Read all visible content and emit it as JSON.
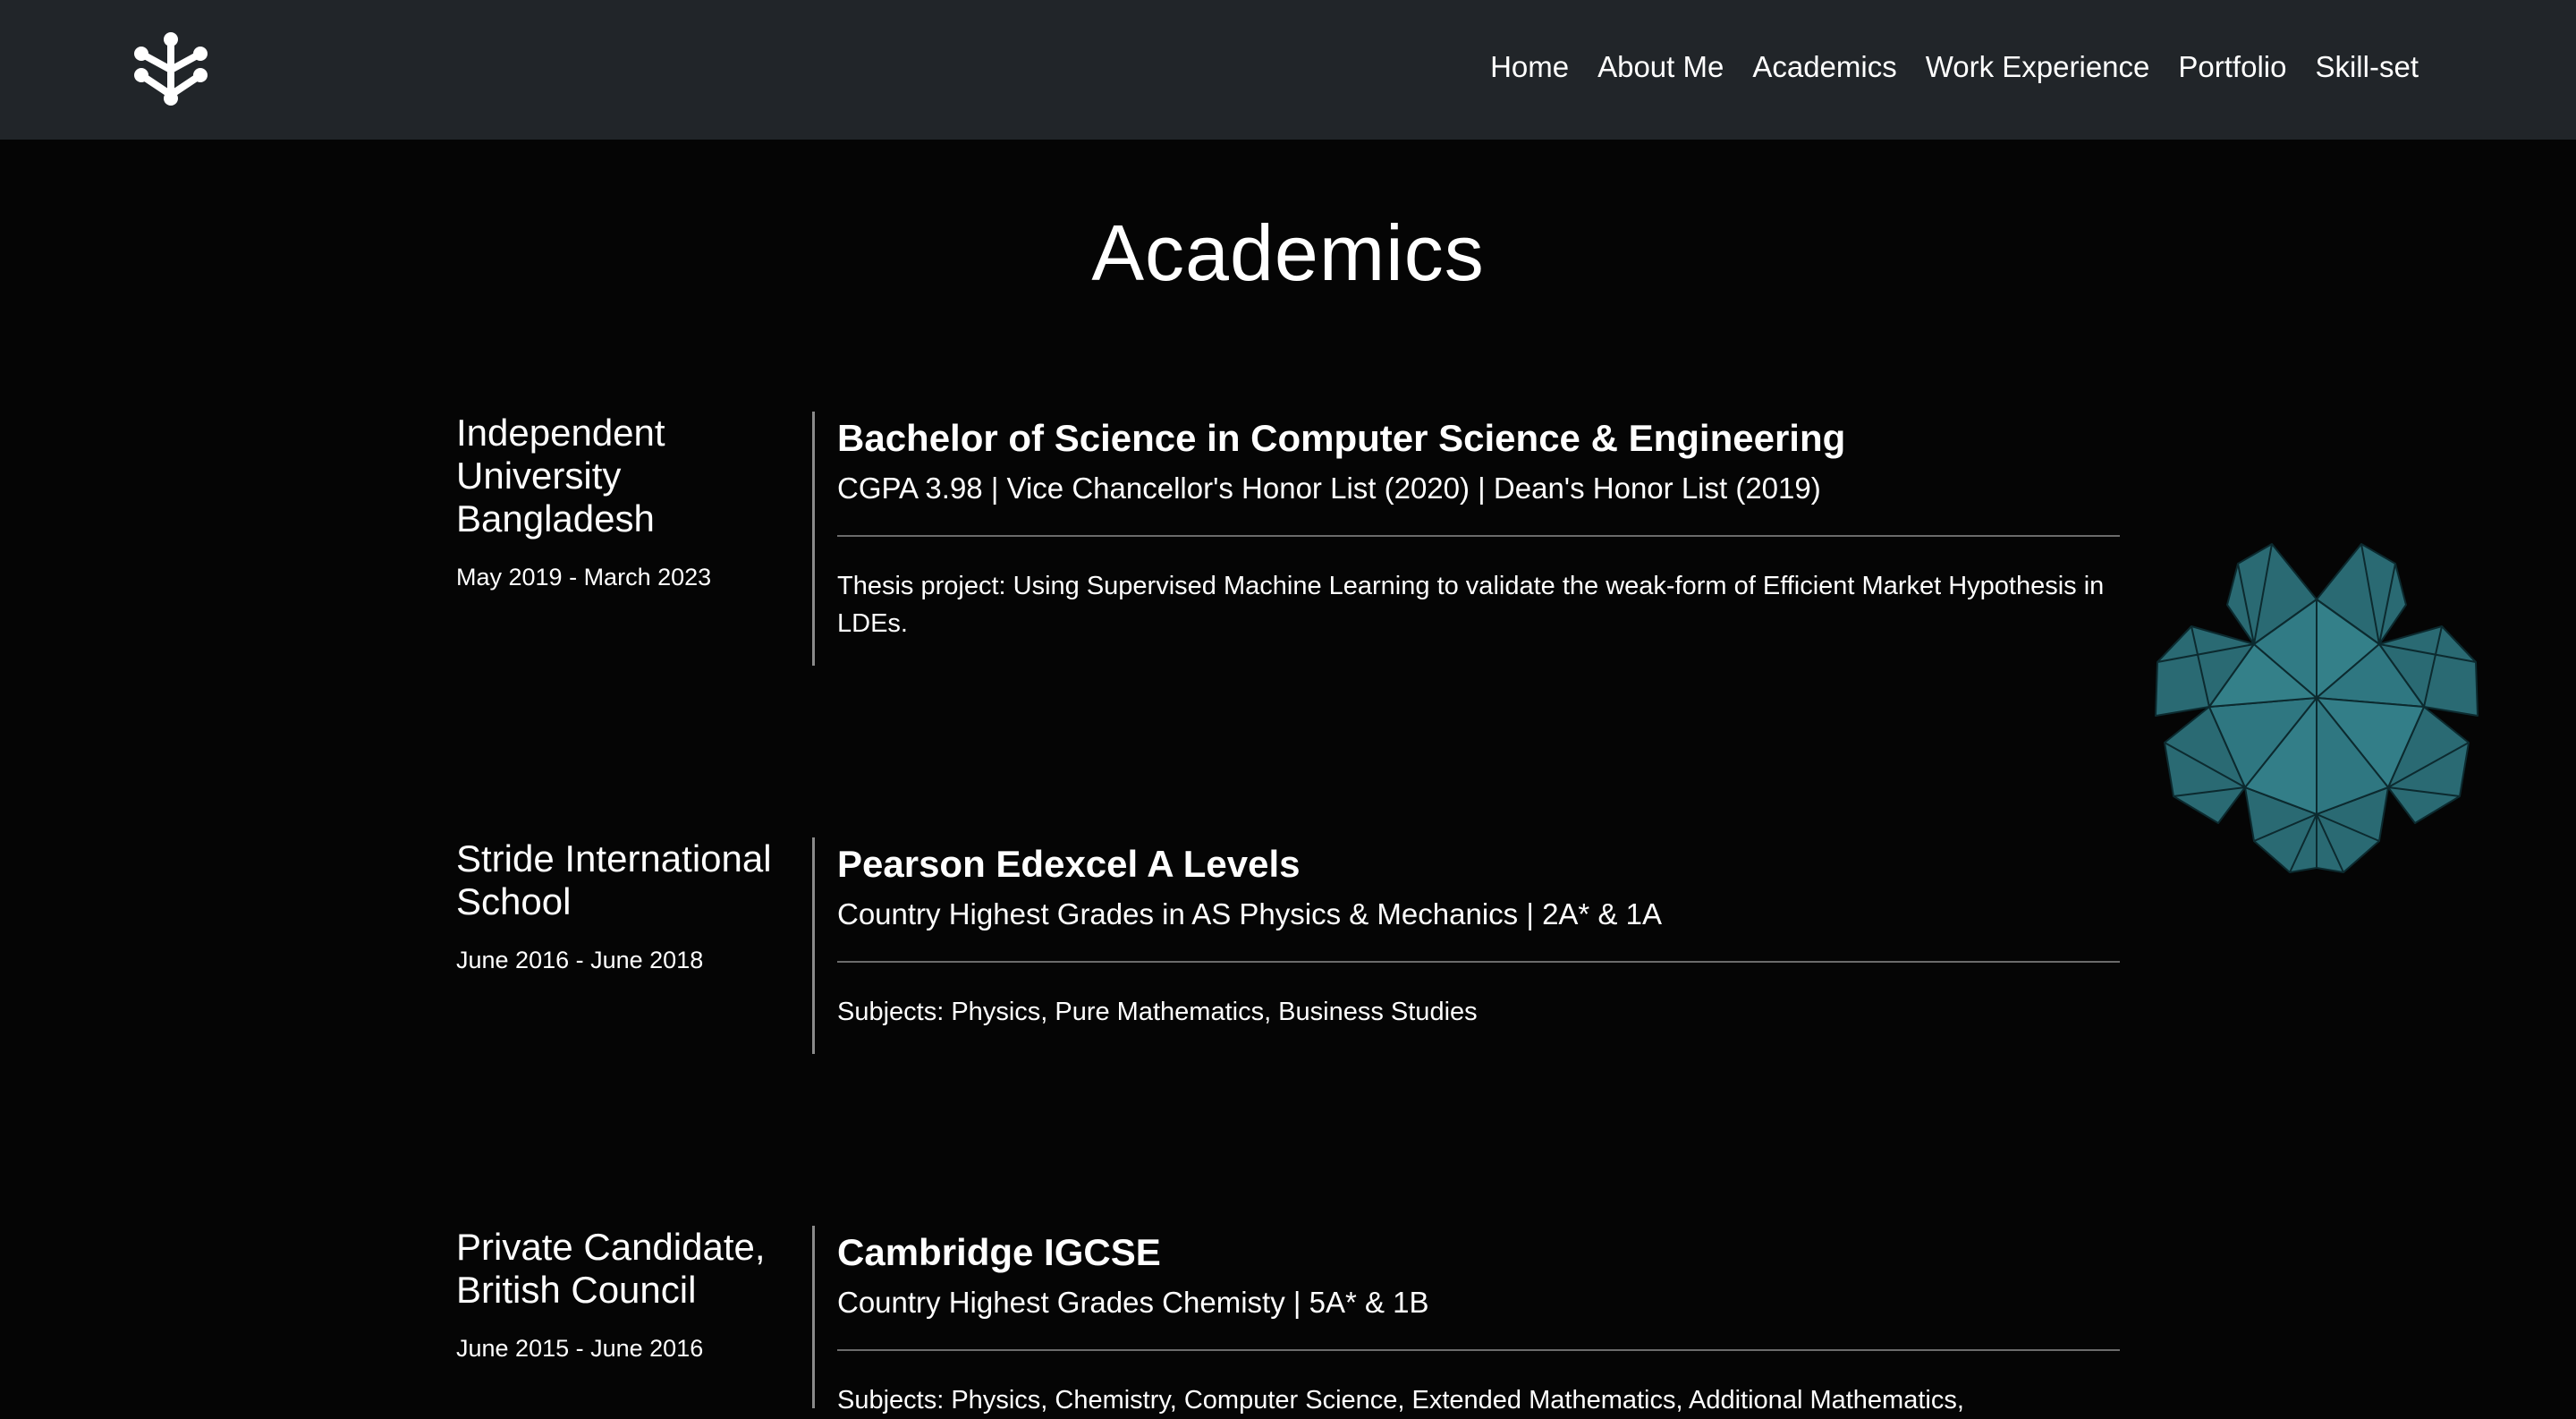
{
  "nav": {
    "logo_icon": "tree-logo-icon",
    "links": [
      "Home",
      "About Me",
      "Academics",
      "Work Experience",
      "Portfolio",
      "Skill-set"
    ]
  },
  "page_title": "Academics",
  "entries": [
    {
      "school": "Independent University Bangladesh",
      "dates": "May 2019 - March 2023",
      "degree": "Bachelor of Science in Computer Science & Engineering",
      "honors": "CGPA 3.98 | Vice Chancellor's Honor List (2020) | Dean's Honor List (2019)",
      "description": "Thesis project: Using Supervised Machine Learning to validate the weak-form of Efficient Market Hypothesis in LDEs."
    },
    {
      "school": "Stride International School",
      "dates": "June 2016 - June 2018",
      "degree": "Pearson Edexcel A Levels",
      "honors": "Country Highest Grades in AS Physics & Mechanics | 2A* & 1A",
      "description": "Subjects: Physics, Pure Mathematics, Business Studies"
    },
    {
      "school": "Private Candidate, British Council",
      "dates": "June 2015 - June 2016",
      "degree": "Cambridge IGCSE",
      "honors": "Country Highest Grades Chemisty | 5A* & 1B",
      "description": "Subjects: Physics, Chemistry, Computer Science, Extended Mathematics, Additional Mathematics,"
    }
  ],
  "colors": {
    "navbar_bg": "#212529",
    "page_bg": "#050505",
    "decor_teal": "#2f7781"
  },
  "decor_icon": "geodesic-flower-icon"
}
